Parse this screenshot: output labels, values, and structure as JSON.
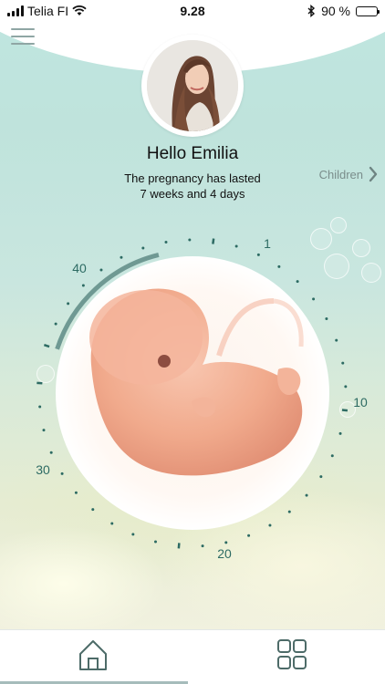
{
  "status_bar": {
    "carrier": "Telia FI",
    "time": "9.28",
    "battery_text": "90 %",
    "battery_level": 0.9
  },
  "header": {
    "menu_icon": "hamburger-menu-icon",
    "avatar_icon": "user-photo"
  },
  "greeting": "Hello Emilia",
  "pregnancy": {
    "line1": "The pregnancy has lasted",
    "line2": "7 weeks and 4 days",
    "current_week": 7.57,
    "total_weeks": 40
  },
  "children_link": "Children",
  "dial": {
    "labels": [
      "1",
      "10",
      "20",
      "30",
      "40"
    ]
  },
  "tabbar": {
    "home_icon": "home-icon",
    "grid_icon": "grid-icon",
    "active_tab": "home"
  },
  "colors": {
    "accent": "#2d6b63",
    "progress": "#6f9993"
  }
}
